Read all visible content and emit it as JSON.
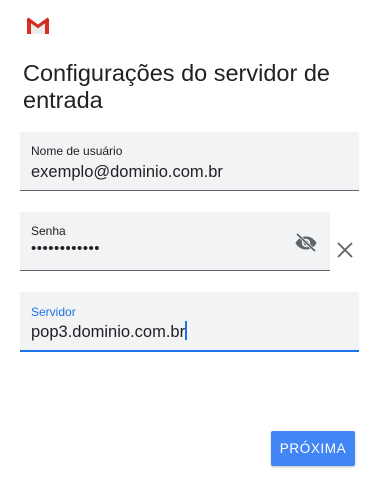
{
  "app": {
    "logo_icon": "gmail-icon",
    "logo_colors": [
      "#c5221f",
      "#ea4335",
      "#d4d4d4"
    ]
  },
  "header": {
    "title": "Configurações do servidor de entrada"
  },
  "form": {
    "username": {
      "label": "Nome de usuário",
      "value": "exemplo@dominio.com.br"
    },
    "password": {
      "label": "Senha",
      "value": "••••••••••••",
      "visibility_icon": "visibility-off-icon",
      "clear_icon": "close-icon"
    },
    "server": {
      "label": "Servidor",
      "value": "pop3.dominio.com.br",
      "focused": true
    }
  },
  "actions": {
    "next_label": "PRÓXIMA"
  },
  "colors": {
    "accent": "#1a73e8",
    "button": "#4285f4",
    "field_bg": "#f1f3f4",
    "text": "#202124"
  }
}
